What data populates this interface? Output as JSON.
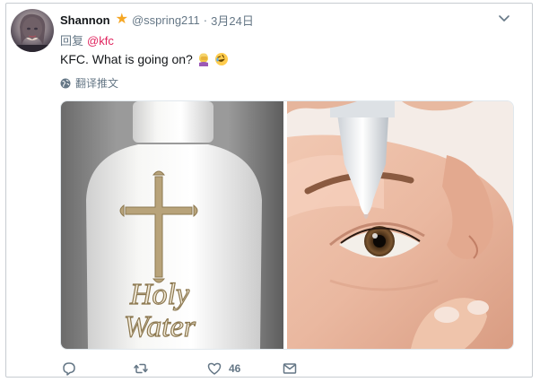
{
  "tweet": {
    "author_name": "Shannon",
    "handle": "@sspring211",
    "separator": "·",
    "date": "3月24日",
    "reply_prefix": "回复",
    "reply_to": "@kfc",
    "text": "KFC. What is going on?",
    "emojis": [
      "woman-facepalming-emoji",
      "rolling-on-floor-laughing-emoji"
    ],
    "translate_label": "翻译推文",
    "media_left": {
      "label_line1": "Holy",
      "label_line2": "Water"
    },
    "like_count": "46"
  },
  "colors": {
    "text_primary": "#14171a",
    "text_secondary": "#657786",
    "mention": "#e0245e",
    "star": "#f5a623",
    "border": "#c7ccd1"
  }
}
